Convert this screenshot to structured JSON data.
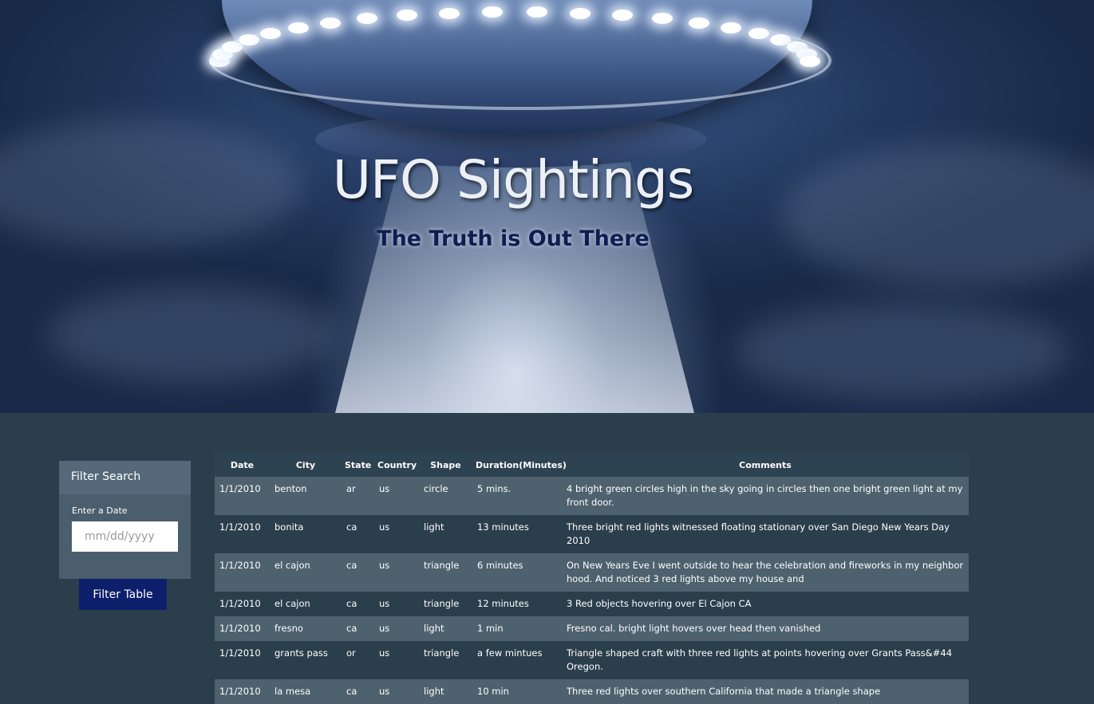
{
  "header": {
    "title": "UFO Sightings",
    "subtitle": "The Truth is Out There"
  },
  "filter": {
    "heading": "Filter Search",
    "date_label": "Enter a Date",
    "date_placeholder": "mm/dd/yyyy",
    "button_label": "Filter Table"
  },
  "table": {
    "columns": [
      "Date",
      "City",
      "State",
      "Country",
      "Shape",
      "Duration(Minutes)",
      "Comments"
    ],
    "rows": [
      [
        "1/1/2010",
        "benton",
        "ar",
        "us",
        "circle",
        "5 mins.",
        "4 bright green circles high in the sky going in circles then one bright green light at my front door."
      ],
      [
        "1/1/2010",
        "bonita",
        "ca",
        "us",
        "light",
        "13 minutes",
        "Three bright red lights witnessed floating stationary over San Diego New Years Day 2010"
      ],
      [
        "1/1/2010",
        "el cajon",
        "ca",
        "us",
        "triangle",
        "6 minutes",
        "On New Years Eve I went outside to hear the celebration and fireworks in my neighbor hood. And noticed 3 red lights above my house and"
      ],
      [
        "1/1/2010",
        "el cajon",
        "ca",
        "us",
        "triangle",
        "12 minutes",
        "3 Red objects hovering over El Cajon CA"
      ],
      [
        "1/1/2010",
        "fresno",
        "ca",
        "us",
        "light",
        "1 min",
        "Fresno cal. bright light hovers over head then vanished"
      ],
      [
        "1/1/2010",
        "grants pass",
        "or",
        "us",
        "triangle",
        "a few mintues",
        "Triangle shaped craft with three red lights at points hovering over Grants Pass&#44 Oregon."
      ],
      [
        "1/1/2010",
        "la mesa",
        "ca",
        "us",
        "light",
        "10 min",
        "Three red lights over southern California that made a triangle shape"
      ]
    ]
  }
}
